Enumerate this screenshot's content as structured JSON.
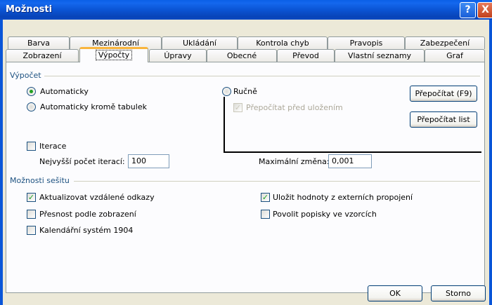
{
  "window": {
    "title": "Možnosti",
    "help_glyph": "?",
    "close_glyph": "X"
  },
  "tabs_row1": [
    "Barva",
    "Mezinárodní",
    "Ukládání",
    "Kontrola chyb",
    "Pravopis",
    "Zabezpečení"
  ],
  "tabs_row2": [
    "Zobrazení",
    "Výpočty",
    "Úpravy",
    "Obecné",
    "Převod",
    "Vlastní seznamy",
    "Graf"
  ],
  "active_tab": "Výpočty",
  "calc": {
    "group_title": "Výpočet",
    "auto": "Automaticky",
    "auto_except_tables": "Automaticky kromě tabulek",
    "manual": "Ručně",
    "recalc_before_save": "Přepočítat před uložením",
    "recalc_now_button": "Přepočítat (F9)",
    "recalc_sheet_button": "Přepočítat list",
    "selected": "Automaticky"
  },
  "iteration": {
    "label": "Iterace",
    "checked": false,
    "max_iterations_label": "Nejvyšší počet iterací:",
    "max_iterations_value": "100",
    "max_change_label": "Maximální změna:",
    "max_change_value": "0,001"
  },
  "workbook": {
    "group_title": "Možnosti sešitu",
    "update_remote_refs": "Aktualizovat vzdálené odkazy",
    "update_remote_refs_checked": true,
    "precision_as_displayed": "Přesnost podle zobrazení",
    "precision_as_displayed_checked": false,
    "date_1904": "Kalendářní systém 1904",
    "date_1904_checked": false,
    "save_external_values": "Uložit hodnoty z externích propojení",
    "save_external_values_checked": true,
    "accept_labels_in_formulas": "Povolit popisky ve vzorcích",
    "accept_labels_in_formulas_checked": false
  },
  "footer": {
    "ok": "OK",
    "cancel": "Storno"
  }
}
